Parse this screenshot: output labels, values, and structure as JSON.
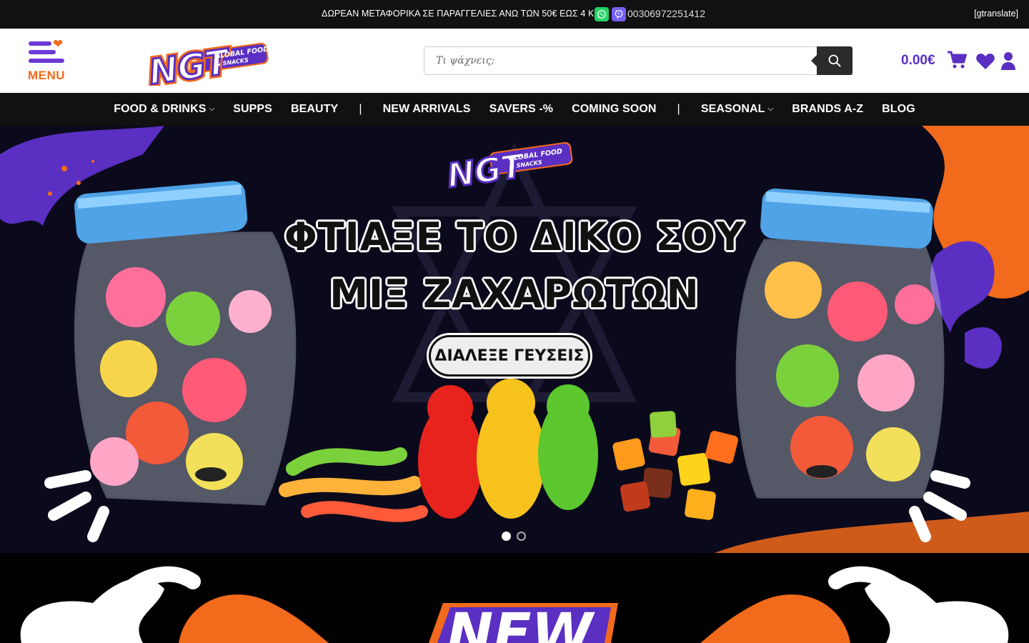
{
  "topbar": {
    "promo": "ΔΩΡΕΑΝ ΜΕΤΑΦΟΡΙΚΑ ΣΕ ΠΑΡΑΓΓΕΛΙΕΣ ΑΝΩ ΤΩΝ 50€ ΕΩΣ 4 ΚΙΛΑ",
    "phone": "00306972251412",
    "translate": "[gtranslate]"
  },
  "header": {
    "menu_label": "MENU",
    "logo_text": "NGT",
    "logo_tagline_1": "GLOBAL FOOD",
    "logo_tagline_2": "& SNACKS",
    "search_placeholder": "Τι ψάχνεις;",
    "cart_total": "0.00€"
  },
  "nav": {
    "items": [
      {
        "label": "FOOD & DRINKS",
        "dropdown": true
      },
      {
        "label": "SUPPS"
      },
      {
        "label": "BEAUTY"
      },
      {
        "label": "|",
        "separator": true
      },
      {
        "label": "NEW ARRIVALS"
      },
      {
        "label": "SAVERS -%"
      },
      {
        "label": "COMING SOON"
      },
      {
        "label": "|",
        "separator": true
      },
      {
        "label": "SEASONAL",
        "dropdown": true
      },
      {
        "label": "BRANDS A-Z"
      },
      {
        "label": "BLOG"
      }
    ]
  },
  "hero": {
    "title_line_1": "ΦΤΙΑΞΕ ΤΟ ΔΙΚΟ ΣΟΥ",
    "title_line_2": "ΜΙΞ ΖΑΧΑΡΩΤΩΝ",
    "cta": "ΔΙΑΛΕΞΕ ΓΕΥΣΕΙΣ",
    "slides": 2,
    "active_slide": 1
  },
  "promo2": {
    "text": "NEW"
  },
  "colors": {
    "brand_purple": "#5a2fc2",
    "brand_orange": "#f26a1b",
    "whatsapp": "#25d366",
    "viber": "#7360f2"
  }
}
